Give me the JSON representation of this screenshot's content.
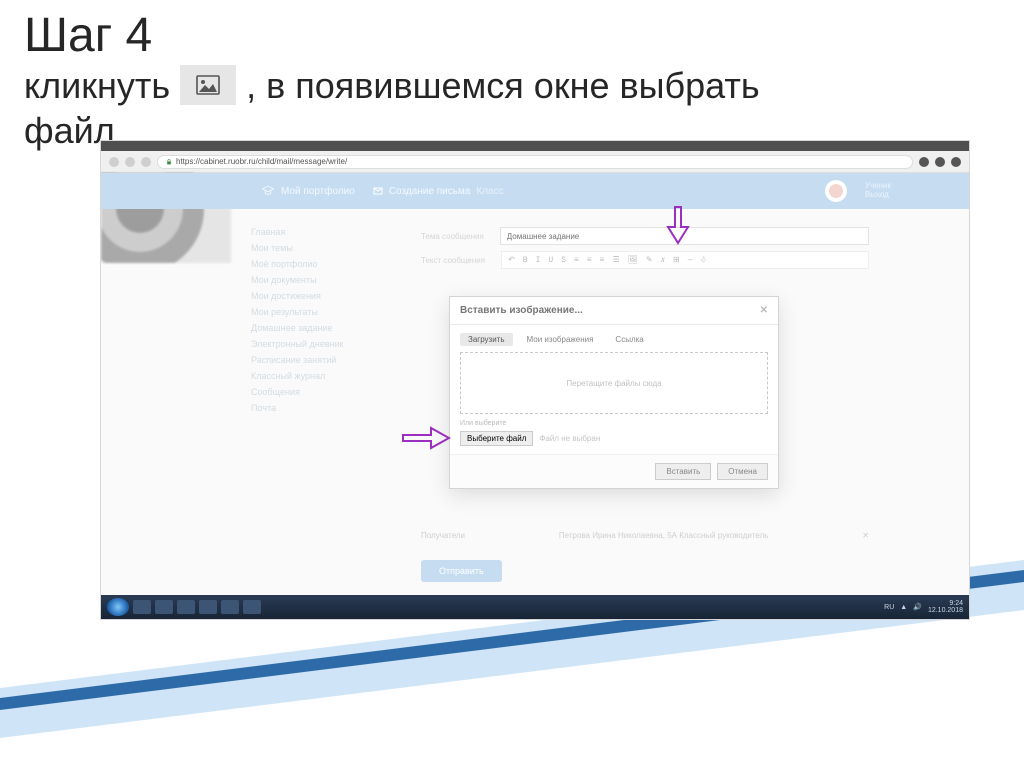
{
  "heading": {
    "title": "Шаг 4",
    "line2_a": "кликнуть",
    "line2_b": ", в появившемся окне выбрать",
    "line3": "файл"
  },
  "browser": {
    "url": "https://cabinet.ruobr.ru/child/mail/message/write/"
  },
  "site": {
    "brand": "Мой портфолио",
    "section": "Создание письма",
    "sub": "Класс",
    "user_line1": "Ученик",
    "user_line2": "Выход"
  },
  "sidebar": {
    "items": [
      "Главная",
      "Мои темы",
      "Моё портфолио",
      "Мои документы",
      "Мои достижения",
      "Мои результаты",
      "Домашнее задание",
      "Электронный дневник",
      "Расписание занятий",
      "Классный журнал",
      "Сообщения",
      "",
      "Почта"
    ]
  },
  "form": {
    "subject_label": "Тема сообщения",
    "subject_placeholder": "Домашнее задание",
    "body_label": "Текст сообщения",
    "toolbar": [
      "↶",
      "B",
      "I",
      "U",
      "S",
      "≡",
      "≡",
      "≡",
      "☰",
      "🖼",
      "✎",
      "𝑥",
      "⊞",
      "—",
      "⎀"
    ]
  },
  "modal": {
    "title": "Вставить изображение...",
    "tabs": {
      "upload": "Загрузить",
      "mine": "Мои изображения",
      "link": "Ссылка"
    },
    "drop_hint": "Перетащите файлы сюда",
    "or": "Или выберите",
    "choose_btn": "Выберите файл",
    "no_file": "Файл не выбран",
    "insert": "Вставить",
    "cancel": "Отмена"
  },
  "below": {
    "recipients_label": "Получатели",
    "recipients_value": "Петрова Ирина Николаевна, 5А Классный руководитель",
    "send": "Отправить"
  },
  "taskbar": {
    "lang": "RU",
    "time": "9:24",
    "date": "12.10.2018"
  }
}
